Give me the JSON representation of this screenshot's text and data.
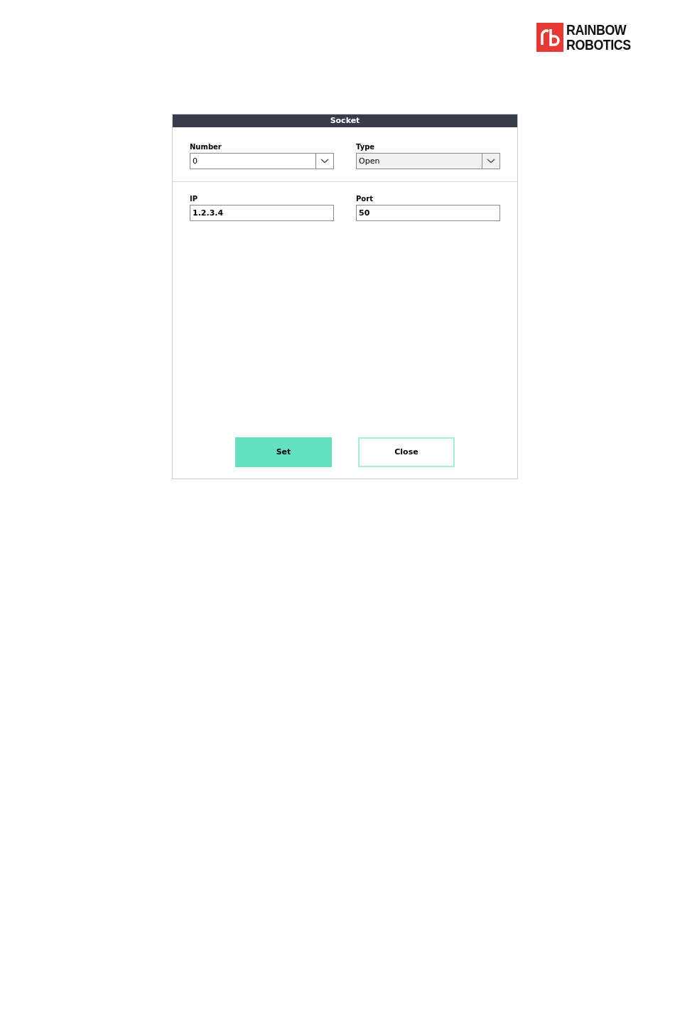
{
  "logo": {
    "lines": [
      "RAINBOW",
      "ROBOTICS"
    ]
  },
  "dialog": {
    "title": "Socket",
    "sections": [
      {
        "fields": [
          {
            "kind": "dropdown",
            "label": "Number",
            "value": "0",
            "disabled": false
          },
          {
            "kind": "dropdown",
            "label": "Type",
            "value": "Open",
            "disabled": true
          }
        ]
      },
      {
        "fields": [
          {
            "kind": "text",
            "label": "IP",
            "value": "1.2.3.4"
          },
          {
            "kind": "text",
            "label": "Port",
            "value": "50"
          }
        ]
      }
    ],
    "buttons": [
      {
        "label": "Set",
        "kind": "primary"
      },
      {
        "label": "Close",
        "kind": "secondary"
      }
    ]
  }
}
